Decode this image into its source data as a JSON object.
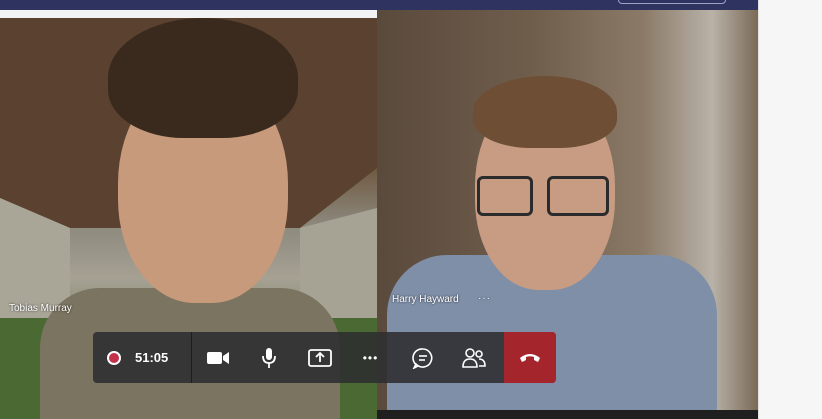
{
  "participants": [
    {
      "name": "Tobias Murray"
    },
    {
      "name": "Harry Hayward",
      "more_label": "···"
    }
  ],
  "call_controls": {
    "timer": "51:05",
    "recording": true,
    "more_label": "•••",
    "icons": [
      "record-icon",
      "video-camera-icon",
      "microphone-icon",
      "share-screen-icon",
      "more-options-icon",
      "chat-icon",
      "participants-icon",
      "hang-up-icon"
    ],
    "colors": {
      "bar": "#2d2d30",
      "hangup": "#a4262c",
      "record": "#c4314b",
      "topbar": "#2f3360"
    }
  }
}
